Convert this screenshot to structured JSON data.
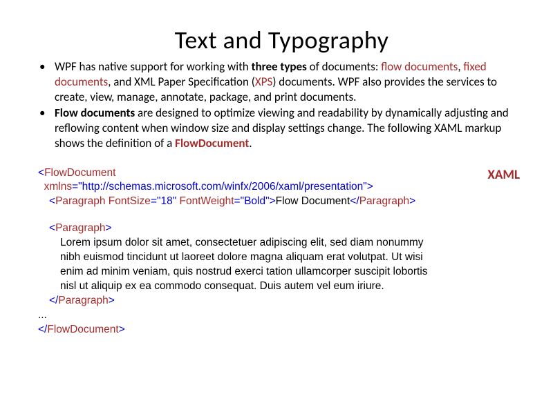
{
  "title": "Text and Typography",
  "bullets": {
    "b1": {
      "t1": "WPF has native support for working with ",
      "bold1": "three types",
      "t2": " of documents: ",
      "link1": "flow documents",
      "t3": ", ",
      "link2": "fixed documents",
      "t4": ", and XML Paper Specification (",
      "link3": "XPS",
      "t5": ") documents. WPF also provides the services to create, view, manage, annotate, package, and print documents."
    },
    "b2": {
      "bold1": "Flow documents",
      "t1": " are designed to optimize viewing and readability by dynamically adjusting and reflowing content when window size and display settings change. The following XAML markup shows the definition of a ",
      "link1": "FlowDocument",
      "t2": "."
    }
  },
  "xaml_label": "XAML",
  "code": {
    "l1a": "<",
    "l1b": "FlowDocument",
    "l2a": "  xmlns",
    "l2b": "=\"http://schemas.microsoft.com/winfx/2006/xaml/presentation\">",
    "l3a": "<",
    "l3b": "Paragraph",
    "l3c": " FontSize",
    "l3d": "=\"18\" ",
    "l3e": "FontWeight",
    "l3f": "=\"Bold\">",
    "l3g": "Flow Document",
    "l3h": "</",
    "l3i": "Paragraph",
    "l3j": ">",
    "l4a": "<",
    "l4b": "Paragraph",
    "l4c": ">",
    "l5": "Lorem ipsum dolor sit amet, consectetuer adipiscing elit, sed diam nonummy",
    "l6": "nibh euismod tincidunt ut laoreet dolore magna aliquam erat volutpat. Ut wisi",
    "l7": "enim ad minim veniam, quis nostrud exerci tation ullamcorper suscipit lobortis",
    "l8": "nisl ut aliquip ex ea commodo consequat. Duis autem vel eum iriure.",
    "l9a": "</",
    "l9b": "Paragraph",
    "l9c": ">",
    "l10": "...",
    "l11a": "</",
    "l11b": "FlowDocument",
    "l11c": ">"
  }
}
